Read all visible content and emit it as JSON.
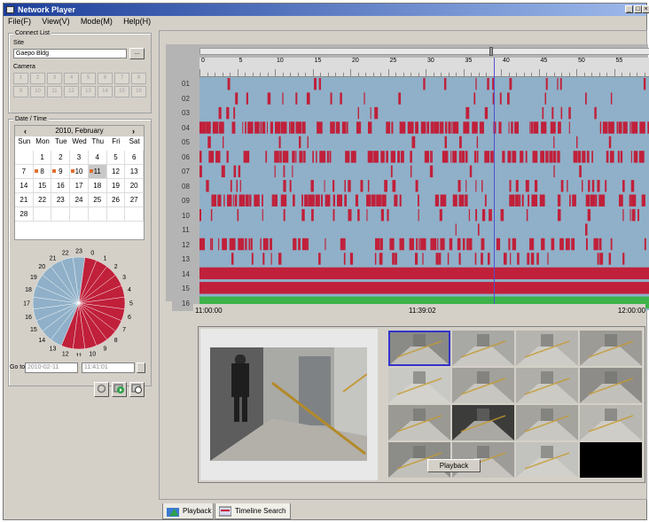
{
  "window": {
    "title": "Network Player"
  },
  "menu": [
    "File(F)",
    "View(V)",
    "Mode(M)",
    "Help(H)"
  ],
  "connect": {
    "group_label": "Connect List",
    "site_label": "Site",
    "site_value": "Gaepo Bldg",
    "browse_label": "...",
    "camera_label": "Camera",
    "cameras": [
      "1",
      "2",
      "3",
      "4",
      "5",
      "6",
      "7",
      "8",
      "9",
      "10",
      "11",
      "12",
      "13",
      "14",
      "15",
      "16"
    ]
  },
  "datetime": {
    "group_label": "Date / Time",
    "month_label": "2010, February",
    "weekdays": [
      "Sun",
      "Mon",
      "Tue",
      "Wed",
      "Thu",
      "Fri",
      "Sat"
    ],
    "weeks": [
      [
        "",
        "1",
        "2",
        "3",
        "4",
        "5",
        "6"
      ],
      [
        "7",
        "8",
        "9",
        "10",
        "11",
        "12",
        "13"
      ],
      [
        "14",
        "15",
        "16",
        "17",
        "18",
        "19",
        "20"
      ],
      [
        "21",
        "22",
        "23",
        "24",
        "25",
        "26",
        "27"
      ],
      [
        "28",
        "",
        "",
        "",
        "",
        "",
        ""
      ]
    ],
    "recorded_days": [
      "8",
      "9",
      "10",
      "11"
    ],
    "selected_day": "11",
    "clock_hours": [
      "23",
      "0",
      "1",
      "2",
      "3",
      "4",
      "5",
      "6",
      "7",
      "8",
      "9",
      "10",
      "11",
      "12",
      "13",
      "14",
      "15",
      "16",
      "17",
      "18",
      "19",
      "20",
      "21",
      "22"
    ],
    "goto_label": "Go to",
    "goto_date": "2010-02-11",
    "goto_time": "11:41:01"
  },
  "timeline": {
    "ruler_ticks": [
      "0",
      "5",
      "10",
      "15",
      "20",
      "25",
      "30",
      "35",
      "40",
      "45",
      "50",
      "55"
    ],
    "channels": [
      "01",
      "02",
      "03",
      "04",
      "05",
      "06",
      "07",
      "08",
      "09",
      "10",
      "11",
      "12",
      "13",
      "14",
      "15",
      "16"
    ],
    "start_time": "11:00:00",
    "current_time": "11:39:02",
    "end_time": "12:00:00",
    "playhead_minute": 39.03,
    "colors": {
      "recorded": "#c0203a",
      "idle": "#8fb0c8",
      "continuous": "#3cb34a"
    }
  },
  "buttons": {
    "playback": "Playback"
  },
  "tabs": [
    {
      "label": "Playback",
      "icon": "playback-icon"
    },
    {
      "label": "Timeline Search",
      "icon": "timeline-search-icon"
    }
  ]
}
